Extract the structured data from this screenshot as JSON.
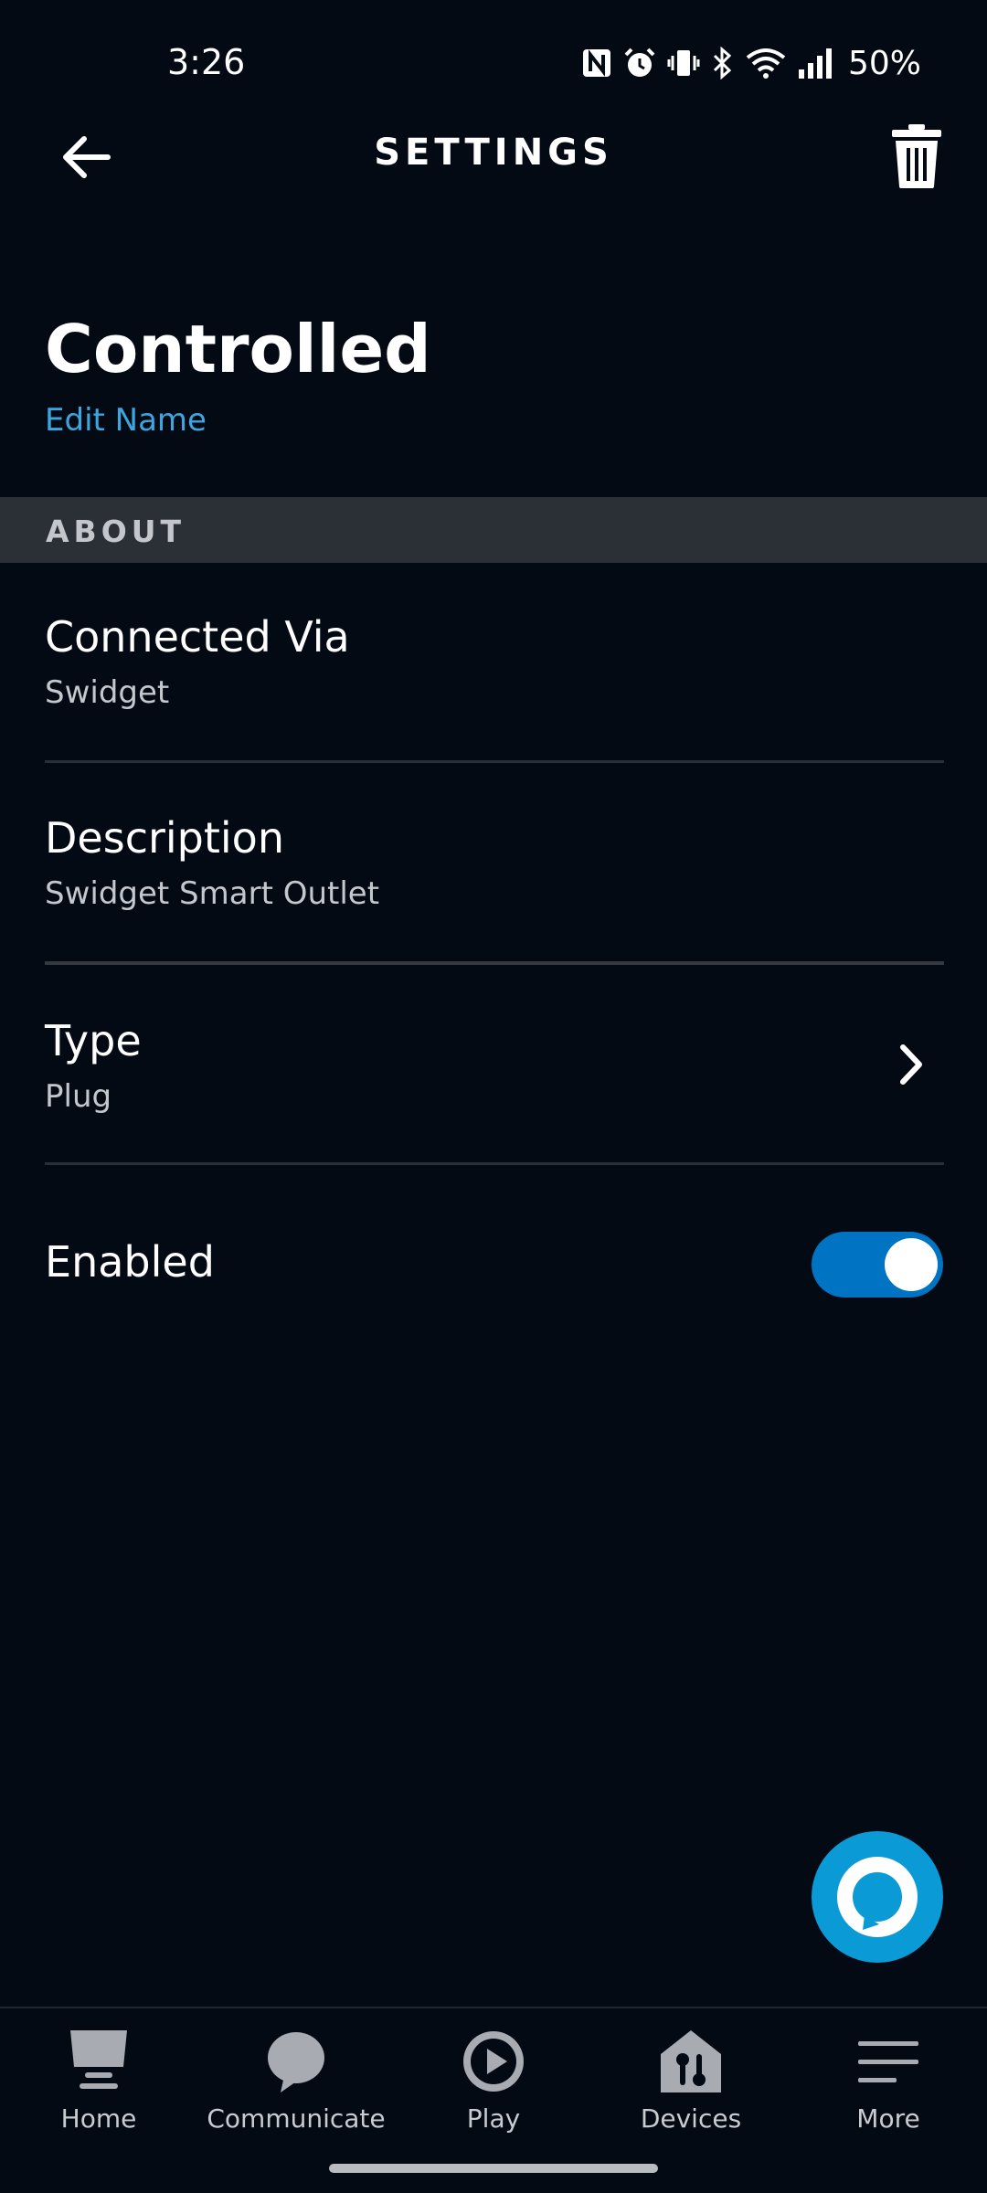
{
  "status_bar": {
    "time": "3:26",
    "battery": "50%",
    "icons": [
      "nfc-icon",
      "alarm-icon",
      "vibrate-icon",
      "bluetooth-icon",
      "wifi-icon",
      "signal-icon"
    ]
  },
  "app_bar": {
    "title": "SETTINGS",
    "back_icon": "arrow-left-icon",
    "delete_icon": "trash-icon"
  },
  "device": {
    "name": "Controlled",
    "edit_label": "Edit Name"
  },
  "about": {
    "header": "ABOUT",
    "rows": [
      {
        "title": "Connected Via",
        "value": "Swidget"
      },
      {
        "title": "Description",
        "value": "Swidget Smart Outlet"
      },
      {
        "title": "Type",
        "value": "Plug"
      }
    ]
  },
  "enabled": {
    "label": "Enabled",
    "value": true
  },
  "colors": {
    "background": "#030a14",
    "accent": "#3ca6e0",
    "toggle_on": "#0074c2",
    "alexa": "#0a9ad6",
    "section_bg": "#2b2f36"
  },
  "bottom_nav": [
    {
      "label": "Home",
      "icon": "home-icon"
    },
    {
      "label": "Communicate",
      "icon": "chat-bubble-icon"
    },
    {
      "label": "Play",
      "icon": "play-icon"
    },
    {
      "label": "Devices",
      "icon": "devices-icon"
    },
    {
      "label": "More",
      "icon": "menu-icon"
    }
  ]
}
